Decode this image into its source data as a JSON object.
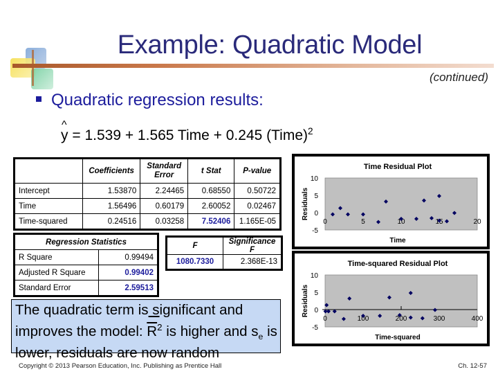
{
  "slide": {
    "title": "Example: Quadratic Model",
    "subtitle_note": "(continued)",
    "bullet": "Quadratic regression results:",
    "equation": {
      "lhs": "y",
      "hat": "^",
      "rhs": "= 1.539 + 1.565 Time + 0.245 (Time)",
      "exponent": "2"
    },
    "colors": {
      "title": "#2a2a7a",
      "bullet": "#1c1c9c",
      "highlight_value": "#1c1c9c",
      "callout_bg": "#c6d9f4",
      "plot_bg": "#c0c0c0",
      "marker": "#000060"
    }
  },
  "coefficients_table": {
    "headers": [
      "",
      "Coefficients",
      "Standard Error",
      "t Stat",
      "P-value"
    ],
    "rows": [
      {
        "label": "Intercept",
        "coef": "1.53870",
        "se": "2.24465",
        "t": "0.68550",
        "p": "0.50722"
      },
      {
        "label": "Time",
        "coef": "1.56496",
        "se": "0.60179",
        "t": "2.60052",
        "p": "0.02467"
      },
      {
        "label": "Time-squared",
        "coef": "0.24516",
        "se": "0.03258",
        "t": "7.52406",
        "p": "1.165E-05"
      }
    ]
  },
  "regression_statistics": {
    "header": "Regression Statistics",
    "rows": [
      {
        "label": "R Square",
        "value": "0.99494"
      },
      {
        "label": "Adjusted R Square",
        "value": "0.99402"
      },
      {
        "label": "Standard Error",
        "value": "2.59513"
      }
    ]
  },
  "f_table": {
    "headers": [
      "F",
      "Significance F"
    ],
    "values": [
      "1080.7330",
      "2.368E-13"
    ]
  },
  "callout": {
    "line1_a": "The quadratic term is",
    "line1_s": " s",
    "line1_b": "ignificant and",
    "line2_a": "improves the model: ",
    "line2_r": "R",
    "line2_sup": "2",
    "line2_b": " is higher and s",
    "line2_sub": "e",
    "line2_c": " is",
    "line3": "lower, residuals are now random"
  },
  "chart_data": [
    {
      "type": "scatter",
      "title": "Time  Residual Plot",
      "xlabel": "Time",
      "ylabel": "Residuals",
      "xlim": [
        0,
        20
      ],
      "ylim": [
        -5,
        10
      ],
      "xticks": [
        "0",
        "5",
        "10",
        "15",
        "20"
      ],
      "yticks": [
        "10",
        "5",
        "0",
        "-5"
      ],
      "points": [
        {
          "x": 1,
          "y": -0.5
        },
        {
          "x": 2,
          "y": 1.3
        },
        {
          "x": 3,
          "y": -0.5
        },
        {
          "x": 5,
          "y": -0.5
        },
        {
          "x": 7,
          "y": -2.7
        },
        {
          "x": 8,
          "y": 3.2
        },
        {
          "x": 10,
          "y": -1.8
        },
        {
          "x": 12,
          "y": -1.8
        },
        {
          "x": 13,
          "y": 3.5
        },
        {
          "x": 14,
          "y": -1.6
        },
        {
          "x": 15,
          "y": 4.8
        },
        {
          "x": 15,
          "y": -2.3
        },
        {
          "x": 16,
          "y": -2.5
        },
        {
          "x": 17,
          "y": -0.1
        }
      ]
    },
    {
      "type": "scatter",
      "title": "Time-squared  Residual Plot",
      "xlabel": "Time-squared",
      "ylabel": "Residuals",
      "xlim": [
        0,
        400
      ],
      "ylim": [
        -5,
        10
      ],
      "xticks": [
        "0",
        "100",
        "200",
        "300",
        "400"
      ],
      "yticks": [
        "10",
        "5",
        "0",
        "-5"
      ],
      "points": [
        {
          "x": 1,
          "y": -0.5
        },
        {
          "x": 4,
          "y": 1.3
        },
        {
          "x": 9,
          "y": -0.5
        },
        {
          "x": 25,
          "y": -0.5
        },
        {
          "x": 49,
          "y": -2.7
        },
        {
          "x": 64,
          "y": 3.2
        },
        {
          "x": 100,
          "y": -1.8
        },
        {
          "x": 144,
          "y": -1.8
        },
        {
          "x": 169,
          "y": 3.5
        },
        {
          "x": 196,
          "y": -1.6
        },
        {
          "x": 225,
          "y": 4.8
        },
        {
          "x": 225,
          "y": -2.3
        },
        {
          "x": 256,
          "y": -2.5
        },
        {
          "x": 289,
          "y": -0.1
        }
      ]
    }
  ],
  "footer": {
    "copyright": "Copyright © 2013 Pearson Education, Inc. Publishing as Prentice Hall",
    "page": "Ch. 12-57"
  }
}
